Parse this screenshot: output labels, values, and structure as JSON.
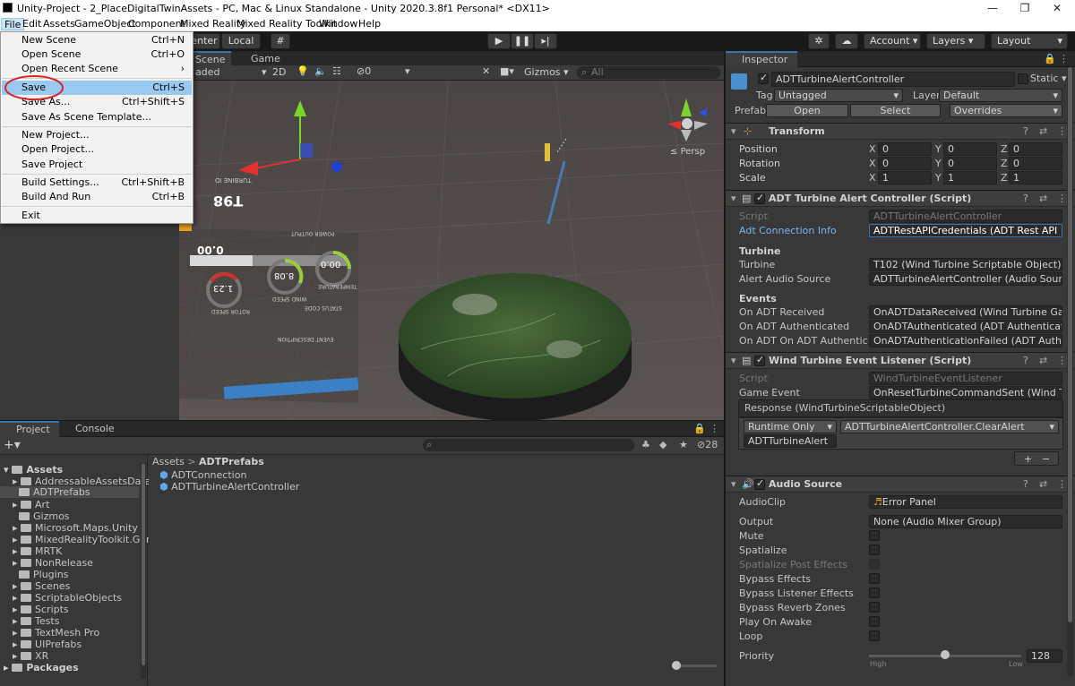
{
  "window": {
    "title": "Unity-Project - 2_PlaceDigitalTwinAssets - PC, Mac & Linux Standalone - Unity 2020.3.8f1 Personal* <DX11>"
  },
  "menubar": [
    "File",
    "Edit",
    "Assets",
    "GameObject",
    "Component",
    "Mixed Reality",
    "Mixed Reality Toolkit",
    "Window",
    "Help"
  ],
  "toolbar": {
    "center": "enter",
    "local": "Local",
    "account": "Account",
    "layers": "Layers",
    "layout": "Layout"
  },
  "file_menu": [
    {
      "label": "New Scene",
      "shortcut": "Ctrl+N"
    },
    {
      "label": "Open Scene",
      "shortcut": "Ctrl+O"
    },
    {
      "label": "Open Recent Scene",
      "shortcut": ""
    },
    {
      "label": "Save",
      "shortcut": "Ctrl+S"
    },
    {
      "label": "Save As...",
      "shortcut": "Ctrl+Shift+S"
    },
    {
      "label": "Save As Scene Template...",
      "shortcut": ""
    },
    {
      "label": "New Project...",
      "shortcut": ""
    },
    {
      "label": "Open Project...",
      "shortcut": ""
    },
    {
      "label": "Save Project",
      "shortcut": ""
    },
    {
      "label": "Build Settings...",
      "shortcut": "Ctrl+Shift+B"
    },
    {
      "label": "Build And Run",
      "shortcut": "Ctrl+B"
    },
    {
      "label": "Exit",
      "shortcut": ""
    }
  ],
  "scene": {
    "tab_scene": "Scene",
    "tab_game": "Game",
    "shading": "aded",
    "mode2d": "2D",
    "hidden_count": "0",
    "gizmos": "Gizmos",
    "search_placeholder": "All",
    "persp": "Persp",
    "overlay": {
      "turbine_id_label": "TURBINE ID",
      "turbine_id": "T98",
      "power_output": "POWER OUTPUT",
      "power_val": "0.00",
      "wind_speed": "WIND SPEED",
      "wind_val": "8.08",
      "temperature": "TEMPERATURE",
      "temp_val": "00.0",
      "rotor_speed": "ROTOR SPEED",
      "rotor_val": "1.23",
      "status_code": "STATUS CODE",
      "event_desc": "EVENT DESCRIPTION"
    }
  },
  "inspector": {
    "tab": "Inspector",
    "object_name": "ADTTurbineAlertController",
    "static": "Static",
    "tag_label": "Tag",
    "tag": "Untagged",
    "layer_label": "Layer",
    "layer": "Default",
    "prefab_label": "Prefab",
    "open": "Open",
    "select": "Select",
    "overrides": "Overrides",
    "transform": {
      "title": "Transform",
      "position": "Position",
      "rotation": "Rotation",
      "scale": "Scale",
      "pos": [
        "0",
        "0",
        "0"
      ],
      "rot": [
        "0",
        "0",
        "0"
      ],
      "scl": [
        "1",
        "1",
        "1"
      ]
    },
    "alert_script": {
      "title": "ADT Turbine Alert Controller (Script)",
      "script_label": "Script",
      "script": "ADTTurbineAlertController",
      "adt_conn_label": "Adt Connection Info",
      "adt_conn": "ADTRestAPICredentials (ADT Rest API",
      "turbine_header": "Turbine",
      "turbine_label": "Turbine",
      "turbine": "T102 (Wind Turbine Scriptable Object)",
      "audio_label": "Alert Audio Source",
      "audio": "ADTTurbineAlertController (Audio Source",
      "events_header": "Events",
      "ev1_label": "On ADT Received",
      "ev1": "OnADTDataReceived (Wind Turbine Gam",
      "ev2_label": "On ADT Authenticated",
      "ev2": "OnADTAuthenticated (ADT Authenticatio",
      "ev3_label": "On ADT On ADT Authentication",
      "ev3": "OnADTAuthenticationFailed (ADT Authen"
    },
    "listener": {
      "title": "Wind Turbine Event Listener (Script)",
      "script_label": "Script",
      "script": "WindTurbineEventListener",
      "ge_label": "Game Event",
      "ge": "OnResetTurbineCommandSent (Wind Tu",
      "response": "Response (WindTurbineScriptableObject)",
      "runtime": "Runtime Only",
      "method": "ADTTurbineAlertController.ClearAlert",
      "target": "ADTTurbineAlert",
      "plus": "+",
      "minus": "−"
    },
    "audio": {
      "title": "Audio Source",
      "clip_label": "AudioClip",
      "clip": "Error Panel",
      "output_label": "Output",
      "output": "None (Audio Mixer Group)",
      "mute": "Mute",
      "spatialize": "Spatialize",
      "spatialize_post": "Spatialize Post Effects",
      "bypass": "Bypass Effects",
      "bypass_listener": "Bypass Listener Effects",
      "bypass_reverb": "Bypass Reverb Zones",
      "play_awake": "Play On Awake",
      "loop": "Loop",
      "priority": "Priority",
      "priority_val": "128",
      "high": "High",
      "low": "Low",
      "priority_level": 0.5
    }
  },
  "project": {
    "tab_project": "Project",
    "tab_console": "Console",
    "count": "28",
    "breadcrumb_root": "Assets",
    "breadcrumb_leaf": "ADTPrefabs",
    "assets_root": "Assets",
    "folders": [
      "AddressableAssetsData",
      "ADTPrefabs",
      "Art",
      "Gizmos",
      "Microsoft.Maps.Unity",
      "MixedRealityToolkit.Gen",
      "MRTK",
      "NonRelease",
      "Plugins",
      "Scenes",
      "ScriptableObjects",
      "Scripts",
      "Tests",
      "TextMesh Pro",
      "UIPrefabs",
      "XR"
    ],
    "packages": "Packages",
    "files": [
      "ADTConnection",
      "ADTTurbineAlertController"
    ]
  },
  "colors": {
    "accent": "#3a72b0",
    "highlight": "#99c9ef",
    "circle": "#d9252a"
  }
}
